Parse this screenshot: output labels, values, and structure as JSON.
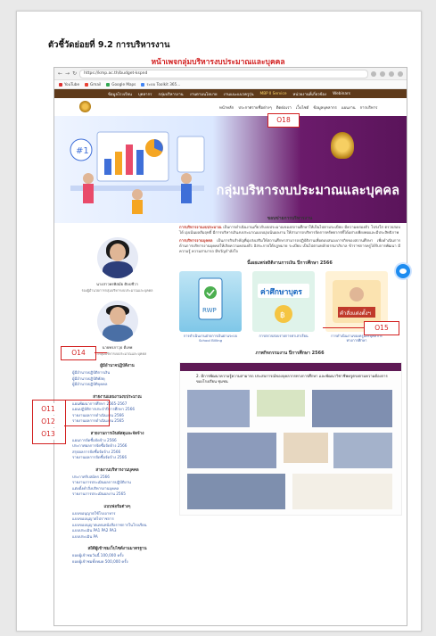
{
  "doc": {
    "title": "ตัวชี้วัดย่อยที่ 9.2 การบริหารงาน",
    "subtitle": "หน้าเพจกลุ่มบริหารงบประมาณและบุคคล"
  },
  "browser": {
    "url": "https://kmp.ac.th/budget-kspnd",
    "bookmarks": [
      "YouTube",
      "Gmail",
      "Google Maps",
      "ระบบ Toolkit 365..."
    ]
  },
  "nav": {
    "items": [
      "ข้อมูลโรงเรียน",
      "บุคลากร",
      "กลุ่มบริหารงาน",
      "งานตามนโยบาย",
      "งานแนะแนวครูรุ่น",
      "MBP Ⅱ Service",
      "หน่วยงานที่เกี่ยวข้อง",
      "Webinars"
    ],
    "highlight": "MBP Ⅱ Service",
    "sub_items": [
      "หน้าหลัก",
      "ประกาศรายชื่อต่างๆ",
      "ติดต่อเรา",
      "เว็บไซต์",
      "ข้อมูลบุคลากร",
      "แผนงาน",
      "การบริหาร"
    ]
  },
  "banner": {
    "title": "กลุ่มบริหารงบประมาณและบุคคล"
  },
  "people": [
    {
      "name": "นางสาวพรพิสมัย ศิลปชีวา",
      "role": "รองผู้อำนวยการกลุ่มบริหารงบประมาณและบุคคล"
    },
    {
      "name": "นายพรภาวุธ ดีเทพ",
      "role": "หัวหน้ากลุ่มบริหารงบประมาณและบุคคล"
    }
  ],
  "left": {
    "section_main": "ผู้มีอำนาจปฏิบัติงาน",
    "main_links": [
      "ผู้มีอำนาจปฏิบัติการเงิน",
      "ผู้มีอำนาจปฏิบัติพัสดุ",
      "ผู้มีอำนาจปฏิบัติบุคคล"
    ],
    "section_plan": "สายงานแผนงานงบประมาณ",
    "plan_links": [
      "แผนพัฒนาการศึกษา 2565-2567",
      "แผนปฏิบัติการประจำปีการศึกษา 2566",
      "รายงานผลการดำเนินงาน 2566",
      "รายงานผลการดำเนินงาน 2565"
    ],
    "section_procure": "สายงานการเงินพัสดุและจัดจ้าง",
    "procure_links": [
      "แผนการจัดซื้อจัดจ้าง 2566",
      "ประกาศผลการจัดซื้อจัดจ้าง 2566",
      "สรุปผลการจัดซื้อจัดจ้าง 2566",
      "รายงานผลการจัดซื้อจัดจ้าง 2566"
    ],
    "section_hr": "สายงานบริหารงานบุคคล",
    "hr_links": [
      "ประกาศรับสมัคร 2566",
      "รายงานการประเมินผลการปฏิบัติงาน",
      "แต่งตั้งคำสั่งบริหารงานบุคคล",
      "รายงานการประเมินผลงาน 2565"
    ],
    "section_misc": "แบบฟอร์มต่างๆ",
    "misc_links": [
      "แบบขอนุญาตใช้โรงอาหาร",
      "แบบขออนุญาตไปราชการ",
      "แบบขออนุญาตแทนหนังสือราชการในโรงเรียน",
      "แบบประเมิน PA1 PA2 PA3",
      "แบบประเมิน PA"
    ],
    "visitor_head": "สถิติผู้เข้าชมเว็บไซต์งานมาตรฐาน",
    "visitor_lines": [
      "ยอดผู้เข้าชมวันนี้ 100,000 ครั้ง",
      "ยอดผู้เข้าชมทั้งหมด 500,000 ครั้ง"
    ]
  },
  "center": {
    "duty_head": "ขอบข่ายการบริหารงาน",
    "para1_lead": "การบริหารงานงบประมาณ",
    "para1": " เป็นการดำเนินงานเกี่ยวกับงบประมาณของสถานศึกษาให้เป็นไปตามระเบียบ มีความคล่องตัว โปร่งใส ตรวจสอบได้ มุ่งเน้นผลสัมฤทธิ์ มีการบริหารเงินงบประมาณแบบมุ่งเน้นผลงาน ให้สามารถบริหารจัดการทรัพยากรที่ได้อย่างเพียงพอและมีประสิทธิภาพ",
    "para2_lead": "การบริหารงานบุคคล",
    "para2": " เป็นภารกิจสำคัญที่มุ่งส่งเสริมให้สถานศึกษาสามารถปฏิบัติงานเพื่อตอบสนองภารกิจของสถานศึกษา เพื่อดำเนินการด้านการบริหารงานบุคคลให้เกิดความคล่องตัว อิสระภายใต้กฎหมาย ระเบียบ เป็นไปตามหลักธรรมาภิบาล ข้าราชการครูได้รับการพัฒนา มีความรู้ ความสามารถ มีขวัญกำลังใจ",
    "year_head": "นี้เผยแพร่สถิติงานการเงิน ปีการศึกษา 2566",
    "cards": [
      {
        "caption": "การดำเนินงานฝ่ายการเงินผ่านระบบ School Billing",
        "label": "RWP"
      },
      {
        "caption": "การตรวจสอบรายการค่าเล่าเรียน",
        "label": "ค่าศึกษาบุตร"
      },
      {
        "caption": "การดำเนินงานของครูและบุคลากรทางการศึกษา",
        "label": "คำสั่งแต่งตั้งฯ"
      }
    ],
    "activity_head": "ภาพกิจกรรมงาน ปีการศึกษา 2566",
    "post_text": "2. มีการพัฒนาความรู้ความสามารถ ประสบการณ์ของบุคลากรทางการศึกษา และพัฒนาวิชาชีพครูตรงตามความต้องการของโรงเรียน ชุมชน"
  },
  "callouts": {
    "o18": "O18",
    "o14": "O14",
    "o15": "O15",
    "o11": "O11",
    "o12": "O12",
    "o13": "O13"
  }
}
